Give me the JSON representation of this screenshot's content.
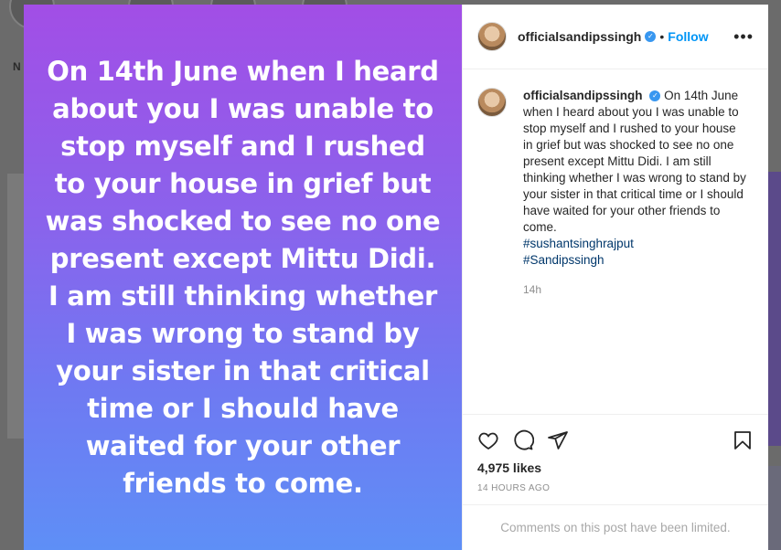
{
  "backdrop": {
    "nav_letter": "N"
  },
  "post": {
    "image_text": "On 14th June when I heard about you I was unable to stop myself and I rushed to your house in grief but was shocked to see no one present except Mittu Didi. I am still thinking whether I was wrong to stand by your sister in that critical time or I should have waited for your other friends to come.",
    "gradient_colors": [
      "#a24ee6",
      "#5e8ff6"
    ]
  },
  "header": {
    "username": "officialsandipssingh",
    "verified_icon": "verified-badge-icon",
    "separator": "•",
    "follow_label": "Follow",
    "more_label": "•••"
  },
  "caption": {
    "username": "officialsandipssingh",
    "text": "On 14th June when I heard about you I was unable to stop myself and I rushed to your house in grief but was shocked to see no one present except Mittu Didi. I am still thinking whether I was wrong to stand by your sister in that critical time or I should have waited for your other friends to come.",
    "hashtags": [
      "#sushantsinghrajput",
      "#Sandipssingh"
    ],
    "time": "14h"
  },
  "actions": {
    "icons": [
      "heart-icon",
      "comment-icon",
      "share-icon",
      "bookmark-icon"
    ],
    "likes": "4,975 likes",
    "posted_ago": "14 HOURS AGO"
  },
  "footer": {
    "limited_text": "Comments on this post have been limited."
  },
  "colors": {
    "accent": "#0095f6",
    "hashtag": "#00376b",
    "muted": "#8e8e8e"
  }
}
